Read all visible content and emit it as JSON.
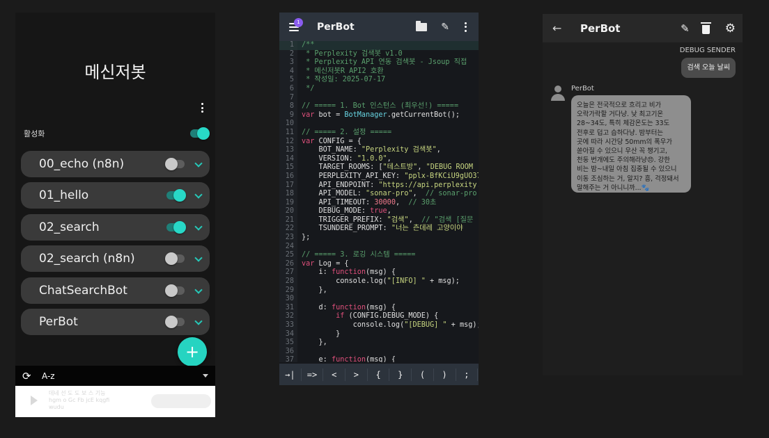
{
  "app_list": {
    "title": "메신저봇",
    "active_label": "활성화",
    "active_on": true,
    "bots": [
      {
        "name": "00_echo (n8n)",
        "on": false
      },
      {
        "name": "01_hello",
        "on": true
      },
      {
        "name": "02_search",
        "on": true
      },
      {
        "name": "02_search (n8n)",
        "on": false
      },
      {
        "name": "ChatSearchBot",
        "on": false
      },
      {
        "name": "PerBot",
        "on": false
      }
    ],
    "fab_label": "+",
    "refresh_glyph": "⟳",
    "sort_label": "A-z",
    "ad_text": "데네 선 도 도 보 스 기능\nhgm o Gc Fb jcE kqgfi\nwudu"
  },
  "editor": {
    "title": "PerBot",
    "badge": "1",
    "pencil_glyph": "✎",
    "lines": [
      {
        "n": "1",
        "hl": true,
        "parts": [
          {
            "t": "/**",
            "c": "comment"
          }
        ]
      },
      {
        "n": "2",
        "parts": [
          {
            "t": " * Perplexity 검색봇 v1.0",
            "c": "comment"
          }
        ]
      },
      {
        "n": "3",
        "parts": [
          {
            "t": " * Perplexity API 연동 검색봇 - Jsoup 직접",
            "c": "comment"
          }
        ]
      },
      {
        "n": "4",
        "parts": [
          {
            "t": " * 메신저봇R API2 호환",
            "c": "comment"
          }
        ]
      },
      {
        "n": "5",
        "parts": [
          {
            "t": " * 작성일: 2025-07-17",
            "c": "comment"
          }
        ]
      },
      {
        "n": "6",
        "parts": [
          {
            "t": " */",
            "c": "comment"
          }
        ]
      },
      {
        "n": "7",
        "parts": [
          {
            "t": "",
            "c": "plain"
          }
        ]
      },
      {
        "n": "8",
        "parts": [
          {
            "t": "// ===== 1. Bot 인스턴스 (최우선!) =====",
            "c": "comment"
          }
        ]
      },
      {
        "n": "9",
        "parts": [
          {
            "t": "var",
            "c": "kw"
          },
          {
            "t": " bot = ",
            "c": "plain"
          },
          {
            "t": "BotManager",
            "c": "fn"
          },
          {
            "t": ".getCurrentBot();",
            "c": "plain"
          }
        ]
      },
      {
        "n": "10",
        "parts": [
          {
            "t": "",
            "c": "plain"
          }
        ]
      },
      {
        "n": "11",
        "parts": [
          {
            "t": "// ===== 2. 설정 =====",
            "c": "comment"
          }
        ]
      },
      {
        "n": "12",
        "parts": [
          {
            "t": "var",
            "c": "kw"
          },
          {
            "t": " CONFIG = {",
            "c": "plain"
          }
        ]
      },
      {
        "n": "13",
        "parts": [
          {
            "t": "    BOT_NAME: ",
            "c": "plain"
          },
          {
            "t": "\"Perplexity 검색봇\"",
            "c": "str"
          },
          {
            "t": ",",
            "c": "plain"
          }
        ]
      },
      {
        "n": "14",
        "parts": [
          {
            "t": "    VERSION: ",
            "c": "plain"
          },
          {
            "t": "\"1.0.0\"",
            "c": "str"
          },
          {
            "t": ",",
            "c": "plain"
          }
        ]
      },
      {
        "n": "15",
        "parts": [
          {
            "t": "    TARGET_ROOMS: [",
            "c": "plain"
          },
          {
            "t": "\"테스트방\"",
            "c": "str"
          },
          {
            "t": ", ",
            "c": "plain"
          },
          {
            "t": "\"DEBUG ROOM",
            "c": "str"
          }
        ]
      },
      {
        "n": "16",
        "parts": [
          {
            "t": "    PERPLEXITY_API_KEY: ",
            "c": "plain"
          },
          {
            "t": "\"pplx-BfKCiU9gUO37",
            "c": "str"
          }
        ]
      },
      {
        "n": "17",
        "parts": [
          {
            "t": "    API_ENDPOINT: ",
            "c": "plain"
          },
          {
            "t": "\"https://api.perplexity.",
            "c": "str"
          }
        ]
      },
      {
        "n": "18",
        "parts": [
          {
            "t": "    API_MODEL: ",
            "c": "plain"
          },
          {
            "t": "\"sonar-pro\"",
            "c": "str"
          },
          {
            "t": ",  ",
            "c": "plain"
          },
          {
            "t": "// sonar-pro",
            "c": "comment"
          }
        ]
      },
      {
        "n": "19",
        "parts": [
          {
            "t": "    API_TIMEOUT: ",
            "c": "plain"
          },
          {
            "t": "30000",
            "c": "num"
          },
          {
            "t": ",  ",
            "c": "plain"
          },
          {
            "t": "// 30초",
            "c": "comment"
          }
        ]
      },
      {
        "n": "20",
        "parts": [
          {
            "t": "    DEBUG_MODE: ",
            "c": "plain"
          },
          {
            "t": "true",
            "c": "kw"
          },
          {
            "t": ",",
            "c": "plain"
          }
        ]
      },
      {
        "n": "21",
        "parts": [
          {
            "t": "    TRIGGER_PREFIX: ",
            "c": "plain"
          },
          {
            "t": "\"검색\"",
            "c": "str"
          },
          {
            "t": ",  ",
            "c": "plain"
          },
          {
            "t": "// \"검색 [질문",
            "c": "comment"
          }
        ]
      },
      {
        "n": "22",
        "parts": [
          {
            "t": "    TSUNDERE_PROMPT: ",
            "c": "plain"
          },
          {
            "t": "\"너는 츤데레 고양이야",
            "c": "str"
          }
        ]
      },
      {
        "n": "23",
        "parts": [
          {
            "t": "};",
            "c": "plain"
          }
        ]
      },
      {
        "n": "24",
        "parts": [
          {
            "t": "",
            "c": "plain"
          }
        ]
      },
      {
        "n": "25",
        "parts": [
          {
            "t": "// ===== 3. 로깅 시스템 =====",
            "c": "comment"
          }
        ]
      },
      {
        "n": "26",
        "parts": [
          {
            "t": "var",
            "c": "kw"
          },
          {
            "t": " Log = {",
            "c": "plain"
          }
        ]
      },
      {
        "n": "27",
        "parts": [
          {
            "t": "    i: ",
            "c": "plain"
          },
          {
            "t": "function",
            "c": "kw"
          },
          {
            "t": "(msg) {",
            "c": "plain"
          }
        ]
      },
      {
        "n": "28",
        "parts": [
          {
            "t": "        console.log(",
            "c": "plain"
          },
          {
            "t": "\"[INFO] \"",
            "c": "str"
          },
          {
            "t": " + msg);",
            "c": "plain"
          }
        ]
      },
      {
        "n": "29",
        "parts": [
          {
            "t": "    },",
            "c": "plain"
          }
        ]
      },
      {
        "n": "30",
        "parts": [
          {
            "t": "",
            "c": "plain"
          }
        ]
      },
      {
        "n": "31",
        "parts": [
          {
            "t": "    d: ",
            "c": "plain"
          },
          {
            "t": "function",
            "c": "kw"
          },
          {
            "t": "(msg) {",
            "c": "plain"
          }
        ]
      },
      {
        "n": "32",
        "parts": [
          {
            "t": "        ",
            "c": "plain"
          },
          {
            "t": "if",
            "c": "kw"
          },
          {
            "t": " (CONFIG.DEBUG_MODE) {",
            "c": "plain"
          }
        ]
      },
      {
        "n": "33",
        "parts": [
          {
            "t": "            console.log(",
            "c": "plain"
          },
          {
            "t": "\"[DEBUG] \"",
            "c": "str"
          },
          {
            "t": " + msg);",
            "c": "plain"
          }
        ]
      },
      {
        "n": "34",
        "parts": [
          {
            "t": "        }",
            "c": "plain"
          }
        ]
      },
      {
        "n": "35",
        "parts": [
          {
            "t": "    },",
            "c": "plain"
          }
        ]
      },
      {
        "n": "36",
        "parts": [
          {
            "t": "",
            "c": "plain"
          }
        ]
      },
      {
        "n": "37",
        "parts": [
          {
            "t": "    e: ",
            "c": "plain"
          },
          {
            "t": "function",
            "c": "kw"
          },
          {
            "t": "(msg) {",
            "c": "plain"
          }
        ]
      }
    ],
    "keys": [
      "→|",
      "=>",
      "<",
      ">",
      "{",
      "}",
      "(",
      ")",
      ";"
    ]
  },
  "chat": {
    "title": "PerBot",
    "back_glyph": "←",
    "pencil_glyph": "✎",
    "gear_glyph": "⚙",
    "sender_name": "DEBUG SENDER",
    "sent_message": "검색 오늘 날씨",
    "bot_sender": "PerBot",
    "bot_message": "오늘은 전국적으로 흐리고 비가\n오락가락할 거다냥. 낮 최고기온\n28~34도, 특히 체감온도는 33도\n전후로 덥고 습하다냥. 밤부터는\n곳에 따라 시간당 50mm의 폭우가\n쏟아질 수 있으니 우산 꼭 챙기고,\n천둥 번개에도 주의해라냥😠. 강한\n비는 밤~내일 아침 집중될 수 있으니\n이동 조심하는 거, 알지? 흥, 걱정돼서\n말해주는 거 아니니까...🐾"
  }
}
